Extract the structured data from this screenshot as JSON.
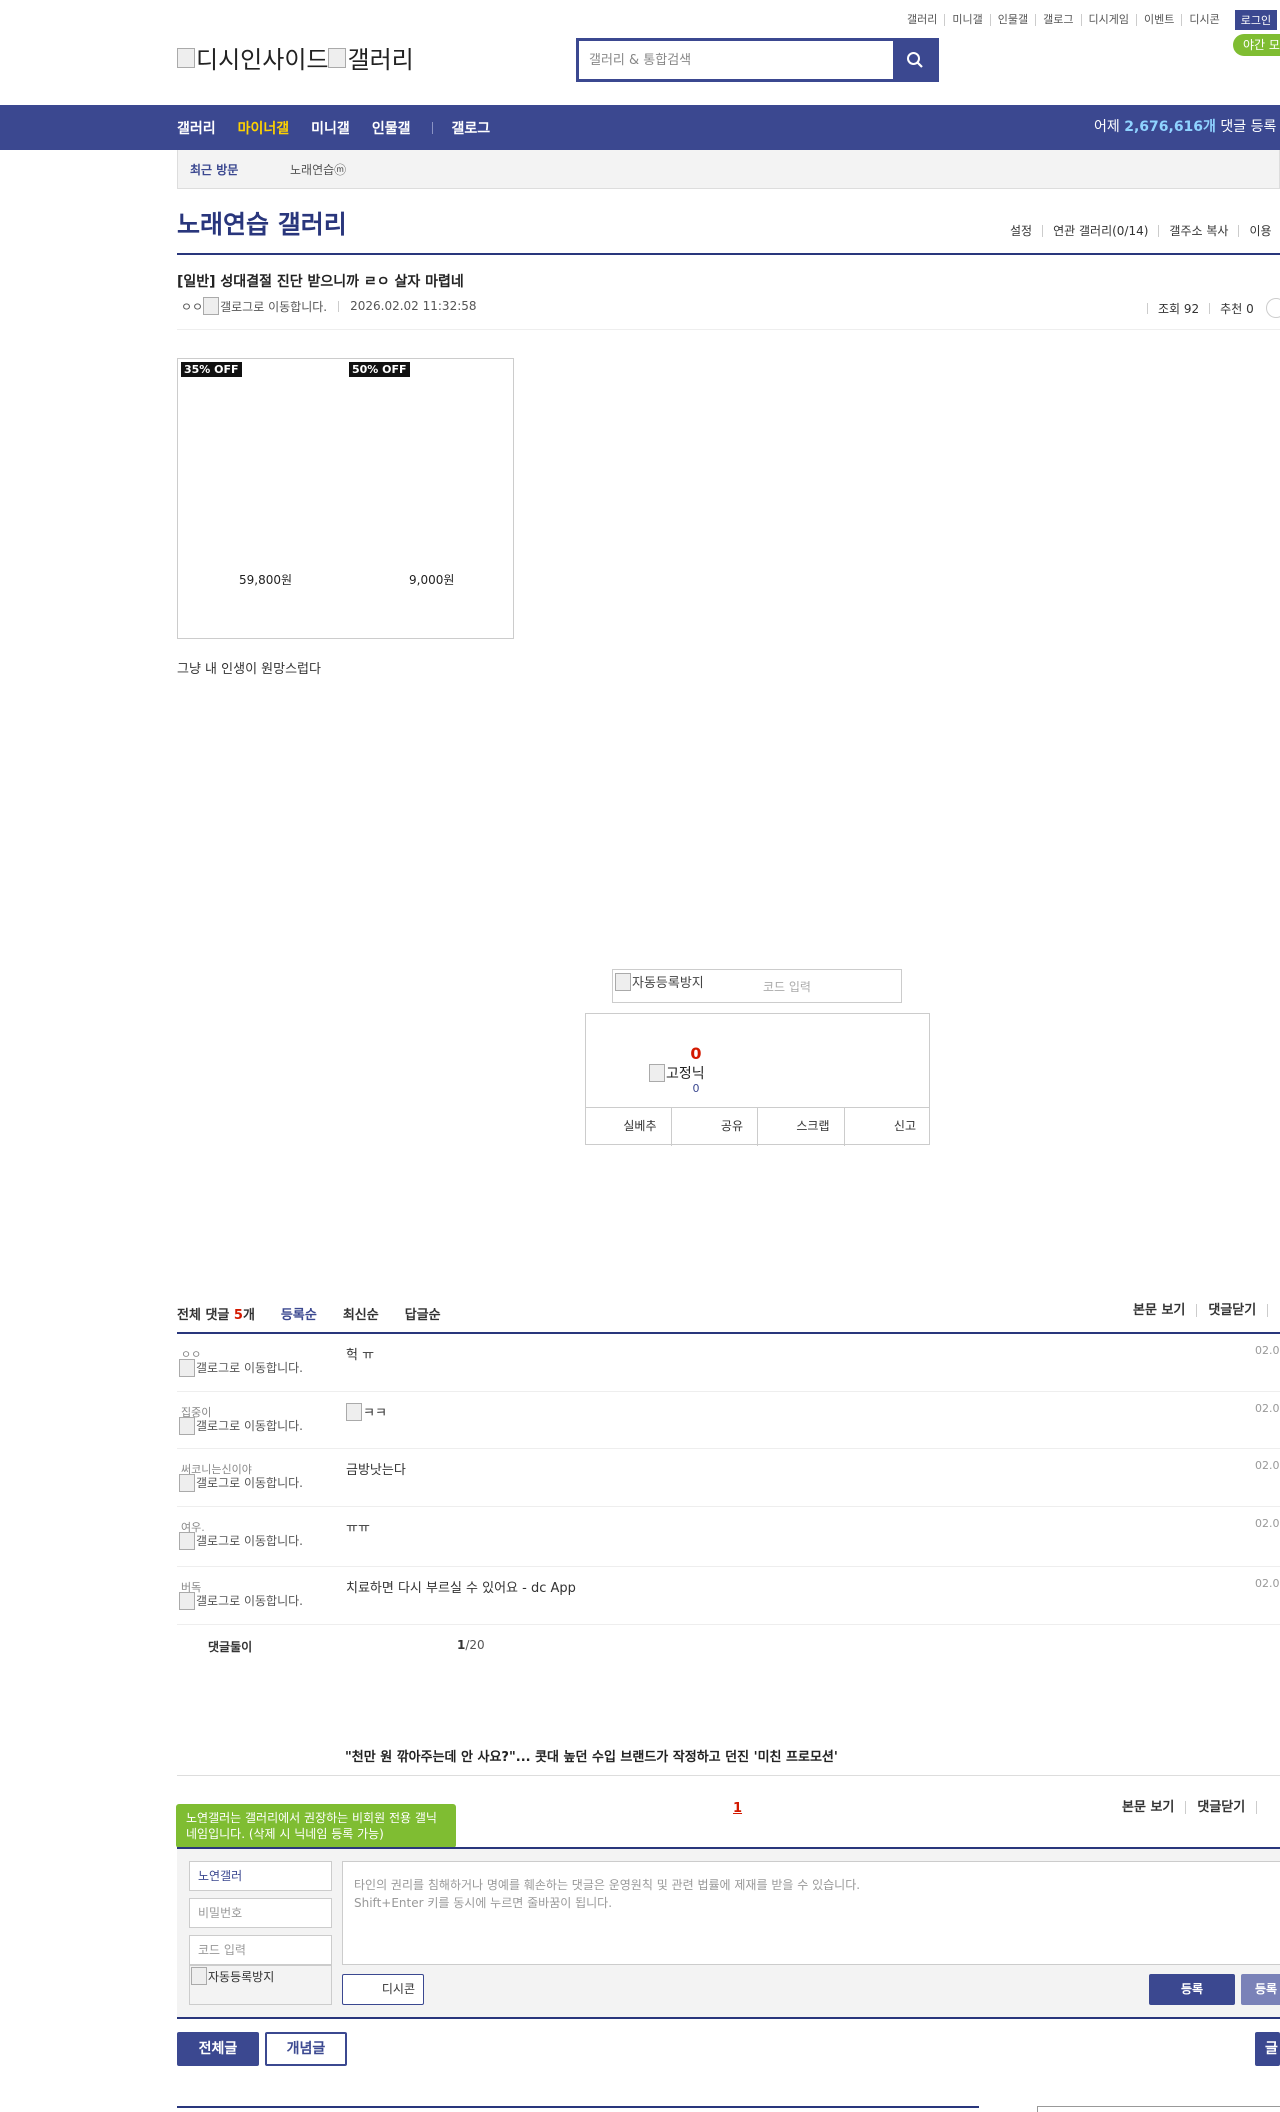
{
  "util_links": [
    "갤러리",
    "미니갤",
    "인물갤",
    "갤로그",
    "디시게임",
    "이벤트",
    "디시콘"
  ],
  "login_label": "로그인",
  "night_label": "야간 모",
  "logo": {
    "site": "디시인사이드",
    "gallery": "갤러리"
  },
  "search": {
    "placeholder": "갤러리 & 통합검색",
    "icon": "search-icon"
  },
  "gnb": {
    "menu": [
      "갤러리",
      "마이너갤",
      "미니갤",
      "인물갤"
    ],
    "gallog": "갤로그",
    "stat_prefix": "어제 ",
    "stat_count": "2,676,616개",
    "stat_suffix": " 댓글 등록"
  },
  "recent": {
    "label": "최근 방문",
    "gallery": "노래연습ⓜ"
  },
  "gallery": {
    "title": "노래연습 갤러리",
    "options": [
      "설정",
      "연관 갤러리(0/14)",
      "갤주소 복사",
      "이용"
    ]
  },
  "post": {
    "title": "[일반] 성대결절 진단 받으니까 ㄹㅇ 살자 마렵네",
    "author": "ㅇㅇ",
    "gallog_img_alt": "갤로그로 이동합니다.",
    "date": "2026.02.02 11:32:58",
    "views": "조회 92",
    "recommend": "추천 0",
    "body": "그냥 내 인생이 원망스럽다"
  },
  "ad": {
    "items": [
      {
        "discount": "35% OFF",
        "price": "59,800원"
      },
      {
        "discount": "50% OFF",
        "price": "9,000원"
      }
    ]
  },
  "captcha": {
    "img_alt": "자동등록방지",
    "placeholder": "코드 입력"
  },
  "vote": {
    "up_count": "0",
    "nick_img_alt": "고정닉",
    "fixed_count": "0",
    "buttons": [
      "실베추",
      "공유",
      "스크랩",
      "신고"
    ]
  },
  "comments": {
    "total_label": "전체 댓글 ",
    "total_count": "5",
    "total_unit": "개",
    "sort": [
      "등록순",
      "최신순",
      "답글순"
    ],
    "right": [
      "본문 보기",
      "댓글닫기"
    ],
    "items": [
      {
        "nick": "ㅇㅇ",
        "text": "헉 ㅠ",
        "date": "02.0"
      },
      {
        "nick": "집중이",
        "text": "ㅋㅋ",
        "date": "02.0"
      },
      {
        "nick": "써코니는신이야",
        "text": "금방낫는다",
        "date": "02.0"
      },
      {
        "nick": "여우.",
        "text": "ㅠㅠ",
        "date": "02.0"
      },
      {
        "nick": "버독",
        "text": "치료하면 다시 부르실 수 있어요 - dc App",
        "date": "02.0"
      }
    ],
    "gallog_alt": "갤로그로 이동합니다.",
    "footer_label": "댓글둘이",
    "page_current": "1",
    "page_total": "/20"
  },
  "promo": "\"천만 원 깎아주는데 안 사요?\"... 콧대 높던 수입 브랜드가 작정하고 던진 '미친 프로모션'",
  "list": {
    "tooltip": "노연갤러는 갤러리에서 권장하는 비회원 전용 갤닉네임입니다. (삭제 시 닉네임 등록 가능)",
    "page": "1",
    "right": [
      "본문 보기",
      "댓글닫기"
    ]
  },
  "write": {
    "nick_value": "노연갤러",
    "password_placeholder": "비밀번호",
    "code_placeholder": "코드 입력",
    "captcha_alt": "자동등록방지",
    "textarea_line1": "타인의 권리를 침해하거나 명예를 훼손하는 댓글은 운영원칙 및 관련 법률에 제재를 받을 수 있습니다.",
    "textarea_line2": "Shift+Enter 키를 동시에 누르면 줄바꿈이 됩니다.",
    "dccon_label": "디시콘",
    "submit_label": "등록",
    "submit2_label": "등록"
  },
  "bottom": {
    "all_posts": "전체글",
    "concept_posts": "개념글",
    "right_partial": "글"
  },
  "colors": {
    "navy": "#3b4890",
    "title_navy": "#29367c",
    "accent_yellow": "#ffd200",
    "green": "#7fbd32",
    "red": "#d31900"
  }
}
